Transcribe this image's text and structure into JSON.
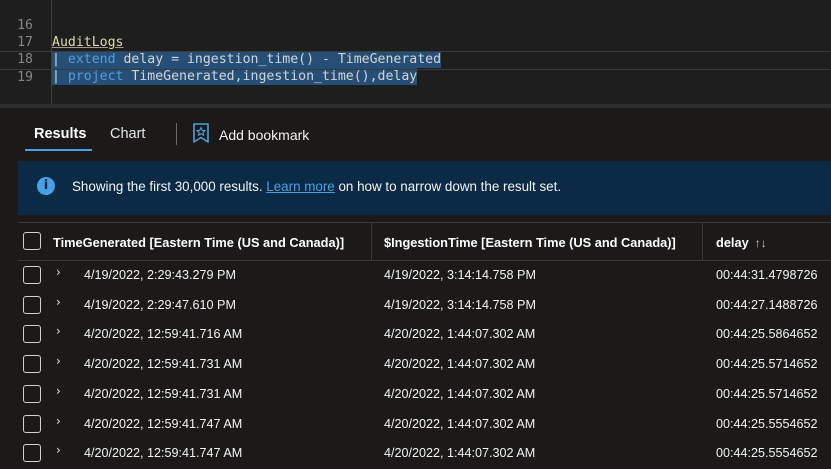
{
  "editor": {
    "lines": [
      {
        "number": "16",
        "table": "AuditLogs"
      },
      {
        "number": "17",
        "pipe": "| ",
        "keyword": "extend",
        "rest": " delay = ingestion_time() - TimeGenerated"
      },
      {
        "number": "18",
        "pipe": "| ",
        "keyword": "project",
        "rest": " TimeGenerated,ingestion_time(),delay"
      },
      {
        "number": "19"
      }
    ]
  },
  "tabs": {
    "results_label": "Results",
    "chart_label": "Chart",
    "bookmark_label": "Add bookmark",
    "bookmark_icon": "bookmark-star-icon"
  },
  "info": {
    "icon": "info-icon",
    "glyph": "i",
    "text_before": "Showing the first 30,000 results. ",
    "link": "Learn more",
    "text_after": " on how to narrow down the result set."
  },
  "grid": {
    "columns": [
      "TimeGenerated [Eastern Time (US and Canada)]",
      "$IngestionTime [Eastern Time (US and Canada)]",
      "delay"
    ],
    "sort_icon": "↑↓",
    "expander_glyph": "›",
    "rows": [
      [
        "4/19/2022, 2:29:43.279 PM",
        "4/19/2022, 3:14:14.758 PM",
        "00:44:31.4798726"
      ],
      [
        "4/19/2022, 2:29:47.610 PM",
        "4/19/2022, 3:14:14.758 PM",
        "00:44:27.1488726"
      ],
      [
        "4/20/2022, 12:59:41.716 AM",
        "4/20/2022, 1:44:07.302 AM",
        "00:44:25.5864652"
      ],
      [
        "4/20/2022, 12:59:41.731 AM",
        "4/20/2022, 1:44:07.302 AM",
        "00:44:25.5714652"
      ],
      [
        "4/20/2022, 12:59:41.731 AM",
        "4/20/2022, 1:44:07.302 AM",
        "00:44:25.5714652"
      ],
      [
        "4/20/2022, 12:59:41.747 AM",
        "4/20/2022, 1:44:07.302 AM",
        "00:44:25.5554652"
      ],
      [
        "4/20/2022, 12:59:41.747 AM",
        "4/20/2022, 1:44:07.302 AM",
        "00:44:25.5554652"
      ]
    ]
  },
  "colors": {
    "accent": "#4aa0e6",
    "info_bg": "#0b2a45",
    "keyword": "#569cd6",
    "table": "#dcdcaa"
  }
}
